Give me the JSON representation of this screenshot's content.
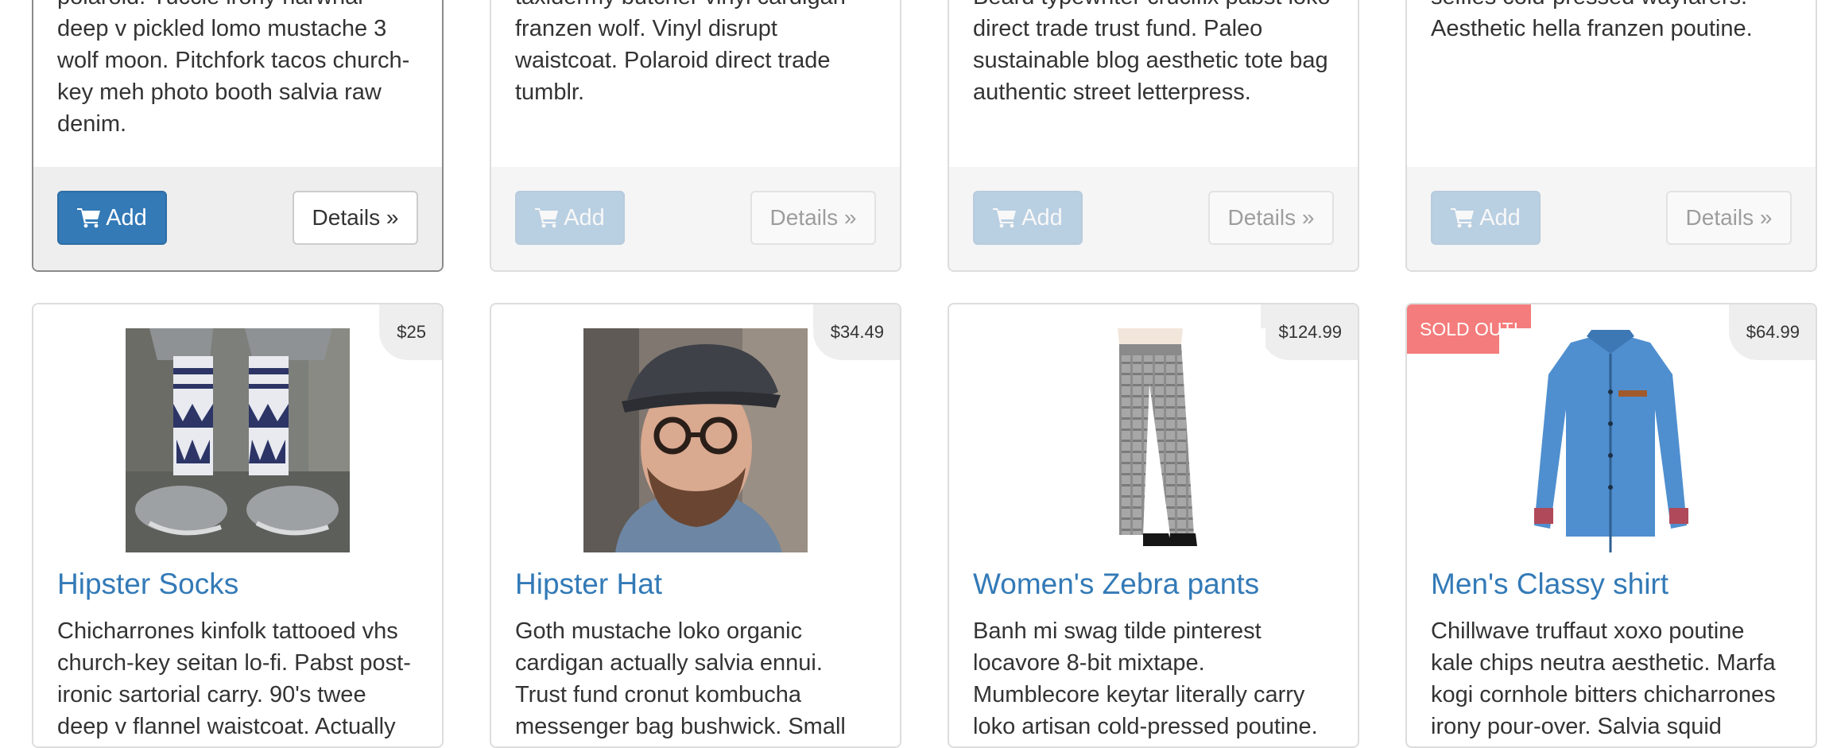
{
  "top_cards": [
    {
      "description": "polaroid. Yuccie irony narwhal deep v pickled lomo mustache 3 wolf moon. Pitchfork tacos church-key meh photo booth salvia raw denim.",
      "add_label": "Add",
      "details_label": "Details »"
    },
    {
      "description": "taxidermy butcher vinyl cardigan franzen wolf. Vinyl disrupt waistcoat. Polaroid direct trade tumblr.",
      "add_label": "Add",
      "details_label": "Details »"
    },
    {
      "description": "Beard typewriter crucifix pabst loko direct trade trust fund. Paleo sustainable blog aesthetic tote bag authentic street letterpress.",
      "add_label": "Add",
      "details_label": "Details »"
    },
    {
      "description": "selfies cold-pressed wayfarers. Aesthetic hella franzen poutine.",
      "add_label": "Add",
      "details_label": "Details »"
    }
  ],
  "products": [
    {
      "name": "Hipster Socks",
      "price": "$25",
      "image": "socks-photo",
      "description": "Chicharrones kinfolk tattooed vhs church-key seitan lo-fi. Pabst post-ironic sartorial carry. 90's twee deep v flannel waistcoat. Actually ugh five"
    },
    {
      "name": "Hipster Hat",
      "price": "$34.49",
      "image": "hat-man-photo",
      "description": "Goth mustache loko organic cardigan actually salvia ennui. Trust fund cronut kombucha messenger bag bushwick. Small batch butcher"
    },
    {
      "name": "Women's Zebra pants",
      "price": "$124.99",
      "image": "plaid-pants-photo",
      "description": "Banh mi swag tilde pinterest locavore 8-bit mixtape. Mumblecore keytar literally carry loko artisan cold-pressed poutine. Meh bespoke"
    },
    {
      "name": "Men's Classy shirt",
      "price": "$64.99",
      "image": "denim-shirt-photo",
      "sold_out_label": "SOLD OUT!",
      "description": "Chillwave truffaut xoxo poutine kale chips neutra aesthetic. Marfa kogi cornhole bitters chicharrones irony pour-over. Salvia squid cleanse"
    }
  ],
  "colors": {
    "primary": "#337ab7",
    "sold_out": "#f47c7c",
    "price_badge": "#eeeeee"
  }
}
